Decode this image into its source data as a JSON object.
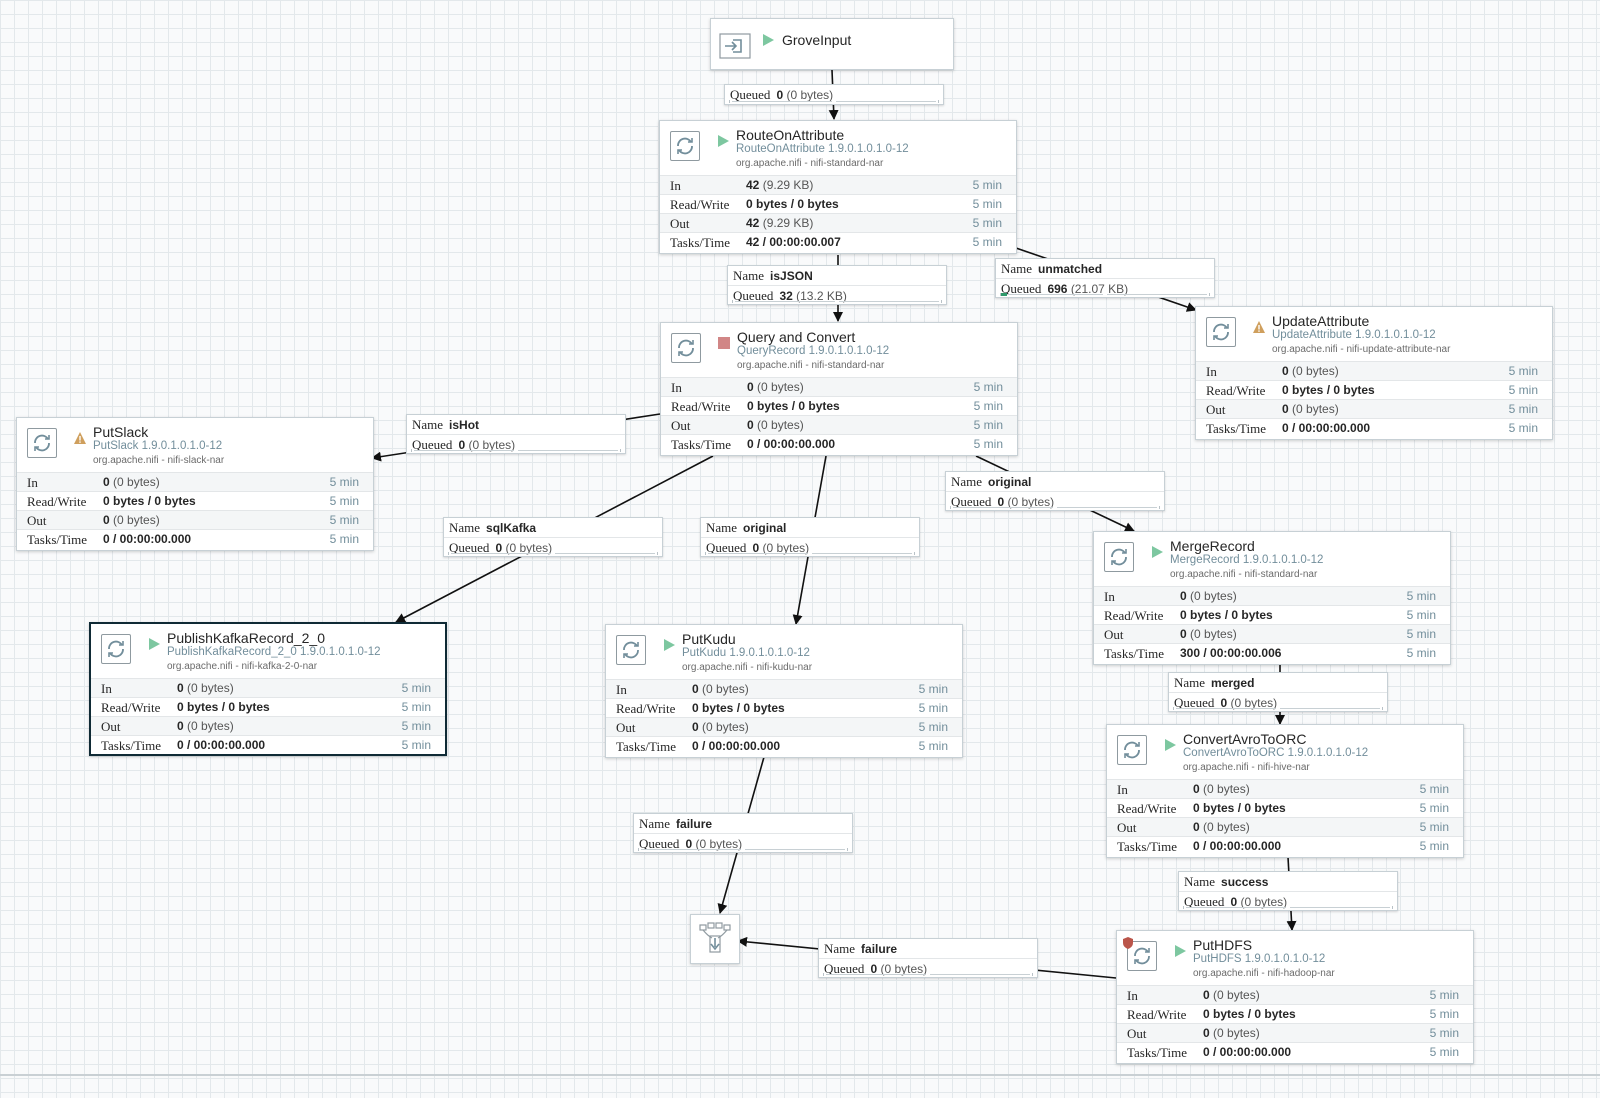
{
  "input_port": {
    "name": "GroveInput",
    "state": "running"
  },
  "funnel": {
    "icon": "funnel-icon"
  },
  "processors": [
    {
      "id": "route",
      "name": "RouteOnAttribute",
      "type": "RouteOnAttribute 1.9.0.1.0.1.0-12",
      "bundle": "org.apache.nifi - nifi-standard-nar",
      "state": "running",
      "warning": false,
      "restricted": false,
      "stats": [
        {
          "label": "In",
          "value": "42",
          "sub": "(9.29 KB)",
          "window": "5 min"
        },
        {
          "label": "Read/Write",
          "value": "0 bytes / 0 bytes",
          "sub": "",
          "window": "5 min"
        },
        {
          "label": "Out",
          "value": "42",
          "sub": "(9.29 KB)",
          "window": "5 min"
        },
        {
          "label": "Tasks/Time",
          "value": "42 / 00:00:00.007",
          "sub": "",
          "window": "5 min"
        }
      ]
    },
    {
      "id": "query",
      "name": "Query and Convert",
      "type": "QueryRecord 1.9.0.1.0.1.0-12",
      "bundle": "org.apache.nifi - nifi-standard-nar",
      "state": "stopped",
      "warning": false,
      "restricted": false,
      "stats": [
        {
          "label": "In",
          "value": "0",
          "sub": "(0 bytes)",
          "window": "5 min"
        },
        {
          "label": "Read/Write",
          "value": "0 bytes / 0 bytes",
          "sub": "",
          "window": "5 min"
        },
        {
          "label": "Out",
          "value": "0",
          "sub": "(0 bytes)",
          "window": "5 min"
        },
        {
          "label": "Tasks/Time",
          "value": "0 / 00:00:00.000",
          "sub": "",
          "window": "5 min"
        }
      ]
    },
    {
      "id": "update",
      "name": "UpdateAttribute",
      "type": "UpdateAttribute 1.9.0.1.0.1.0-12",
      "bundle": "org.apache.nifi - nifi-update-attribute-nar",
      "state": "invalid",
      "warning": true,
      "restricted": false,
      "stats": [
        {
          "label": "In",
          "value": "0",
          "sub": "(0 bytes)",
          "window": "5 min"
        },
        {
          "label": "Read/Write",
          "value": "0 bytes / 0 bytes",
          "sub": "",
          "window": "5 min"
        },
        {
          "label": "Out",
          "value": "0",
          "sub": "(0 bytes)",
          "window": "5 min"
        },
        {
          "label": "Tasks/Time",
          "value": "0 / 00:00:00.000",
          "sub": "",
          "window": "5 min"
        }
      ]
    },
    {
      "id": "slack",
      "name": "PutSlack",
      "type": "PutSlack 1.9.0.1.0.1.0-12",
      "bundle": "org.apache.nifi - nifi-slack-nar",
      "state": "invalid",
      "warning": true,
      "restricted": false,
      "stats": [
        {
          "label": "In",
          "value": "0",
          "sub": "(0 bytes)",
          "window": "5 min"
        },
        {
          "label": "Read/Write",
          "value": "0 bytes / 0 bytes",
          "sub": "",
          "window": "5 min"
        },
        {
          "label": "Out",
          "value": "0",
          "sub": "(0 bytes)",
          "window": "5 min"
        },
        {
          "label": "Tasks/Time",
          "value": "0 / 00:00:00.000",
          "sub": "",
          "window": "5 min"
        }
      ]
    },
    {
      "id": "merge",
      "name": "MergeRecord",
      "type": "MergeRecord 1.9.0.1.0.1.0-12",
      "bundle": "org.apache.nifi - nifi-standard-nar",
      "state": "running",
      "warning": false,
      "restricted": false,
      "stats": [
        {
          "label": "In",
          "value": "0",
          "sub": "(0 bytes)",
          "window": "5 min"
        },
        {
          "label": "Read/Write",
          "value": "0 bytes / 0 bytes",
          "sub": "",
          "window": "5 min"
        },
        {
          "label": "Out",
          "value": "0",
          "sub": "(0 bytes)",
          "window": "5 min"
        },
        {
          "label": "Tasks/Time",
          "value": "300 / 00:00:00.006",
          "sub": "",
          "window": "5 min"
        }
      ]
    },
    {
      "id": "kafka",
      "name": "PublishKafkaRecord_2_0",
      "type": "PublishKafkaRecord_2_0 1.9.0.1.0.1.0-12",
      "bundle": "org.apache.nifi - nifi-kafka-2-0-nar",
      "state": "running",
      "warning": false,
      "restricted": false,
      "stats": [
        {
          "label": "In",
          "value": "0",
          "sub": "(0 bytes)",
          "window": "5 min"
        },
        {
          "label": "Read/Write",
          "value": "0 bytes / 0 bytes",
          "sub": "",
          "window": "5 min"
        },
        {
          "label": "Out",
          "value": "0",
          "sub": "(0 bytes)",
          "window": "5 min"
        },
        {
          "label": "Tasks/Time",
          "value": "0 / 00:00:00.000",
          "sub": "",
          "window": "5 min"
        }
      ]
    },
    {
      "id": "kudu",
      "name": "PutKudu",
      "type": "PutKudu 1.9.0.1.0.1.0-12",
      "bundle": "org.apache.nifi - nifi-kudu-nar",
      "state": "running",
      "warning": false,
      "restricted": false,
      "stats": [
        {
          "label": "In",
          "value": "0",
          "sub": "(0 bytes)",
          "window": "5 min"
        },
        {
          "label": "Read/Write",
          "value": "0 bytes / 0 bytes",
          "sub": "",
          "window": "5 min"
        },
        {
          "label": "Out",
          "value": "0",
          "sub": "(0 bytes)",
          "window": "5 min"
        },
        {
          "label": "Tasks/Time",
          "value": "0 / 00:00:00.000",
          "sub": "",
          "window": "5 min"
        }
      ]
    },
    {
      "id": "orc",
      "name": "ConvertAvroToORC",
      "type": "ConvertAvroToORC 1.9.0.1.0.1.0-12",
      "bundle": "org.apache.nifi - nifi-hive-nar",
      "state": "running",
      "warning": false,
      "restricted": false,
      "stats": [
        {
          "label": "In",
          "value": "0",
          "sub": "(0 bytes)",
          "window": "5 min"
        },
        {
          "label": "Read/Write",
          "value": "0 bytes / 0 bytes",
          "sub": "",
          "window": "5 min"
        },
        {
          "label": "Out",
          "value": "0",
          "sub": "(0 bytes)",
          "window": "5 min"
        },
        {
          "label": "Tasks/Time",
          "value": "0 / 00:00:00.000",
          "sub": "",
          "window": "5 min"
        }
      ]
    },
    {
      "id": "hdfs",
      "name": "PutHDFS",
      "type": "PutHDFS 1.9.0.1.0.1.0-12",
      "bundle": "org.apache.nifi - nifi-hadoop-nar",
      "state": "running",
      "warning": false,
      "restricted": true,
      "stats": [
        {
          "label": "In",
          "value": "0",
          "sub": "(0 bytes)",
          "window": "5 min"
        },
        {
          "label": "Read/Write",
          "value": "0 bytes / 0 bytes",
          "sub": "",
          "window": "5 min"
        },
        {
          "label": "Out",
          "value": "0",
          "sub": "(0 bytes)",
          "window": "5 min"
        },
        {
          "label": "Tasks/Time",
          "value": "0 / 00:00:00.000",
          "sub": "",
          "window": "5 min"
        }
      ]
    }
  ],
  "connections": [
    {
      "id": "c-grove",
      "name": "",
      "queued": "0",
      "queued_size": "(0 bytes)",
      "fill": 0
    },
    {
      "id": "c-isjson",
      "name": "isJSON",
      "queued": "32",
      "queued_size": "(13.2 KB)",
      "fill": 0
    },
    {
      "id": "c-unmatched",
      "name": "unmatched",
      "queued": "696",
      "queued_size": "(21.07 KB)",
      "fill": 0.03
    },
    {
      "id": "c-ishot",
      "name": "isHot",
      "queued": "0",
      "queued_size": "(0 bytes)",
      "fill": 0
    },
    {
      "id": "c-original-right",
      "name": "original",
      "queued": "0",
      "queued_size": "(0 bytes)",
      "fill": 0
    },
    {
      "id": "c-sqlkafka",
      "name": "sqlKafka",
      "queued": "0",
      "queued_size": "(0 bytes)",
      "fill": 0
    },
    {
      "id": "c-original-mid",
      "name": "original",
      "queued": "0",
      "queued_size": "(0 bytes)",
      "fill": 0
    },
    {
      "id": "c-merged",
      "name": "merged",
      "queued": "0",
      "queued_size": "(0 bytes)",
      "fill": 0
    },
    {
      "id": "c-failure-kudu",
      "name": "failure",
      "queued": "0",
      "queued_size": "(0 bytes)",
      "fill": 0
    },
    {
      "id": "c-success",
      "name": "success",
      "queued": "0",
      "queued_size": "(0 bytes)",
      "fill": 0
    },
    {
      "id": "c-failure-hdfs",
      "name": "failure",
      "queued": "0",
      "queued_size": "(0 bytes)",
      "fill": 0
    }
  ],
  "labels": {
    "name": "Name",
    "queued": "Queued"
  },
  "colors": {
    "running": "#7dc7a0",
    "stopped": "#d18686",
    "warning": "#cf9f5d",
    "restricted": "#ba554a",
    "queue_fill": "#2e9a6b",
    "window": "#728e9b",
    "type": "#728e9b"
  }
}
